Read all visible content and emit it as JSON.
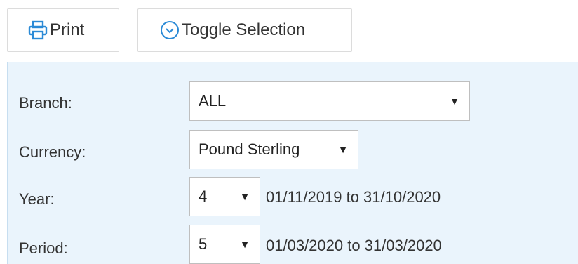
{
  "toolbar": {
    "print_label": "Print",
    "toggle_label": "Toggle Selection"
  },
  "form": {
    "branch": {
      "label": "Branch:",
      "value": "ALL"
    },
    "currency": {
      "label": "Currency:",
      "value": "Pound Sterling"
    },
    "year": {
      "label": "Year:",
      "value": "4",
      "range": "01/11/2019 to 31/10/2020"
    },
    "period": {
      "label": "Period:",
      "value": "5",
      "range": "01/03/2020 to 31/03/2020"
    }
  },
  "colors": {
    "accent": "#2b8ad6",
    "panel_bg": "#eaf4fc"
  },
  "icons": {
    "print": "printer-icon",
    "toggle": "chevron-circle-down-icon",
    "dropdown": "caret-down-icon"
  }
}
